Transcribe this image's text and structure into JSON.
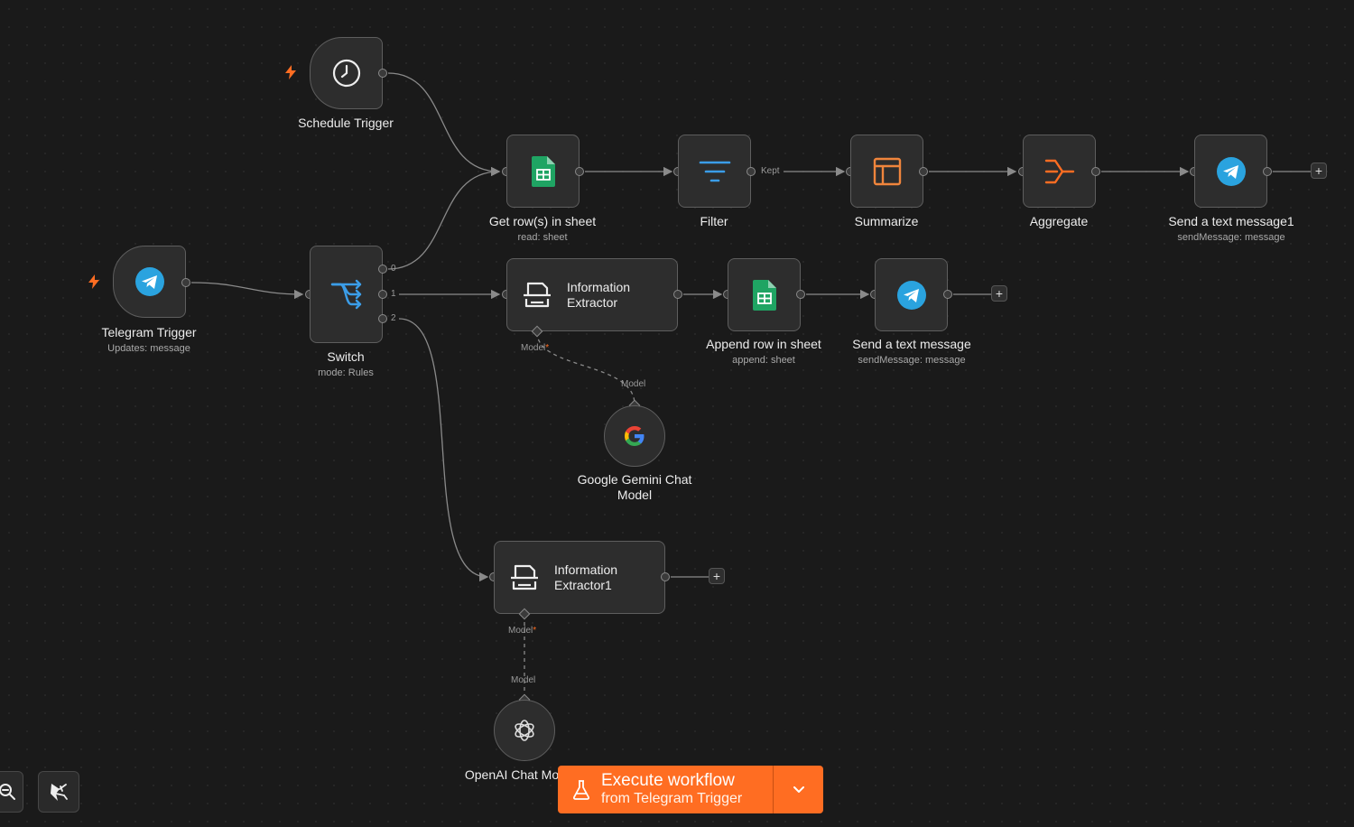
{
  "nodes": {
    "schedule_trigger": {
      "title": "Schedule Trigger"
    },
    "telegram_trigger": {
      "title": "Telegram Trigger",
      "subtitle": "Updates: message"
    },
    "switch": {
      "title": "Switch",
      "subtitle": "mode: Rules",
      "outputs": [
        "0",
        "1",
        "2"
      ]
    },
    "get_rows": {
      "title": "Get row(s) in sheet",
      "subtitle": "read: sheet"
    },
    "filter": {
      "title": "Filter",
      "output_label": "Kept"
    },
    "summarize": {
      "title": "Summarize"
    },
    "aggregate": {
      "title": "Aggregate"
    },
    "send_message1": {
      "title": "Send a text message1",
      "subtitle": "sendMessage: message"
    },
    "info_extractor": {
      "title": "Information Extractor",
      "model_port": "Model"
    },
    "append_row": {
      "title": "Append row in sheet",
      "subtitle": "append: sheet"
    },
    "send_message": {
      "title": "Send a text message",
      "subtitle": "sendMessage: message"
    },
    "gemini_model": {
      "title": "Google Gemini Chat Model",
      "port": "Model"
    },
    "info_extractor1": {
      "title": "Information Extractor1",
      "model_port": "Model"
    },
    "openai_model": {
      "title": "OpenAI Chat Mo",
      "port": "Model"
    }
  },
  "required_marker": "*",
  "plus_symbol": "+",
  "execute": {
    "line1": "Execute workflow",
    "line2": "from Telegram Trigger"
  },
  "icons": {
    "schedule": "clock-icon",
    "telegram": "telegram-icon",
    "switch": "switch-branches-icon",
    "sheets": "google-sheets-icon",
    "filter": "filter-icon",
    "summarize": "table-layout-icon",
    "aggregate": "aggregate-icon",
    "extractor": "document-scanner-icon",
    "gemini": "google-g-icon",
    "openai": "openai-icon",
    "bolt": "lightning-bolt-icon",
    "zoom": "zoom-icon",
    "tidy": "broom-icon",
    "flask": "flask-icon",
    "chevron": "chevron-down-icon"
  },
  "colors": {
    "accent": "#ff6d22",
    "telegram": "#2aa3df",
    "sheets": "#1fa463",
    "filter": "#3b9de8",
    "summarize": "#f0853c",
    "aggregate": "#ff6d22"
  }
}
